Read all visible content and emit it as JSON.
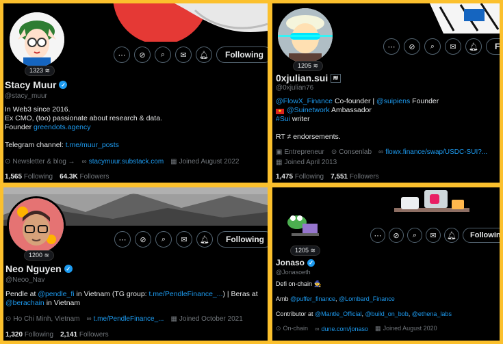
{
  "colors": {
    "frame": "#fbc02d",
    "accent": "#1d9bf0",
    "bg": "#000000",
    "muted": "#71767b"
  },
  "profiles": [
    {
      "subs": "1323",
      "name": "Stacy Muur",
      "handle": "@stacy_muur",
      "bio1": "In Web3 since 2016.",
      "bio2": "Ex CMO, (too) passionate about research & data.",
      "bio3_pre": "Founder ",
      "bio3_link": "greendots.agency",
      "bio4_pre": "Telegram channel: ",
      "bio4_link": "t.me/muur_posts",
      "meta1": "Newsletter & blog",
      "meta1_link": "stacymuur.substack.com",
      "joined": "Joined August 2022",
      "following": "1,565",
      "following_label": "Following",
      "followers": "64.3K",
      "followers_label": "Followers",
      "follow_btn": "Following"
    },
    {
      "subs": "1205",
      "name": "0xjulian.sui",
      "handle": "@0xjulian76",
      "bio1_link": "@FlowX_Finance",
      "bio1_mid": " Co-founder | ",
      "bio1_link2": "@suipiens",
      "bio1_end": " Founder",
      "bio2_link": "@Suinetwork",
      "bio2_end": " Ambassador",
      "bio3_link": "#Sui",
      "bio3_end": " writer",
      "bio4": "RT ≠ endorsements.",
      "meta1": "Entrepreneur",
      "meta2": "Consenlab",
      "meta3_link": "flowx.finance/swap/USDC-SUI?...",
      "joined": "Joined April 2013",
      "following": "1,475",
      "following_label": "Following",
      "followers": "7,551",
      "followers_label": "Followers",
      "follow_btn": "Fo"
    },
    {
      "subs": "1200",
      "name": "Neo Nguyen",
      "handle": "@Neoo_Nav",
      "bio1_pre": "Pendle at ",
      "bio1_link": "@pendle_fi",
      "bio1_mid": " in Vietnam (TG group: ",
      "bio1_link2": "t.me/PendleFinance_...",
      "bio1_end": ") | Beras at",
      "bio2_link": "@berachain",
      "bio2_end": " in Vietnam",
      "meta1": "Ho Chi Minh, Vietnam",
      "meta2_link": "t.me/PendleFinance_...",
      "joined": "Joined October 2021",
      "following": "1,320",
      "following_label": "Following",
      "followers": "2,141",
      "followers_label": "Followers",
      "follow_btn": "Following"
    },
    {
      "subs": "1205",
      "name": "Jonaso",
      "handle": "@Jonasoeth",
      "bio1": "Defi on-chain 🧙",
      "bio2_pre": "Amb ",
      "bio2_link": "@puffer_finance",
      "bio2_sep": ", ",
      "bio2_link2": "@Lombard_Finance",
      "bio3_pre": "Contributor at ",
      "bio3_link": "@Mantle_Official",
      "bio3_sep1": ", ",
      "bio3_link2": "@build_on_bob",
      "bio3_sep2": ", ",
      "bio3_link3": "@ethena_labs",
      "meta1": "On-chain",
      "meta2_link": "dune.com/jonaso",
      "joined": "Joined August 2020",
      "follow_btn": "Following"
    }
  ]
}
